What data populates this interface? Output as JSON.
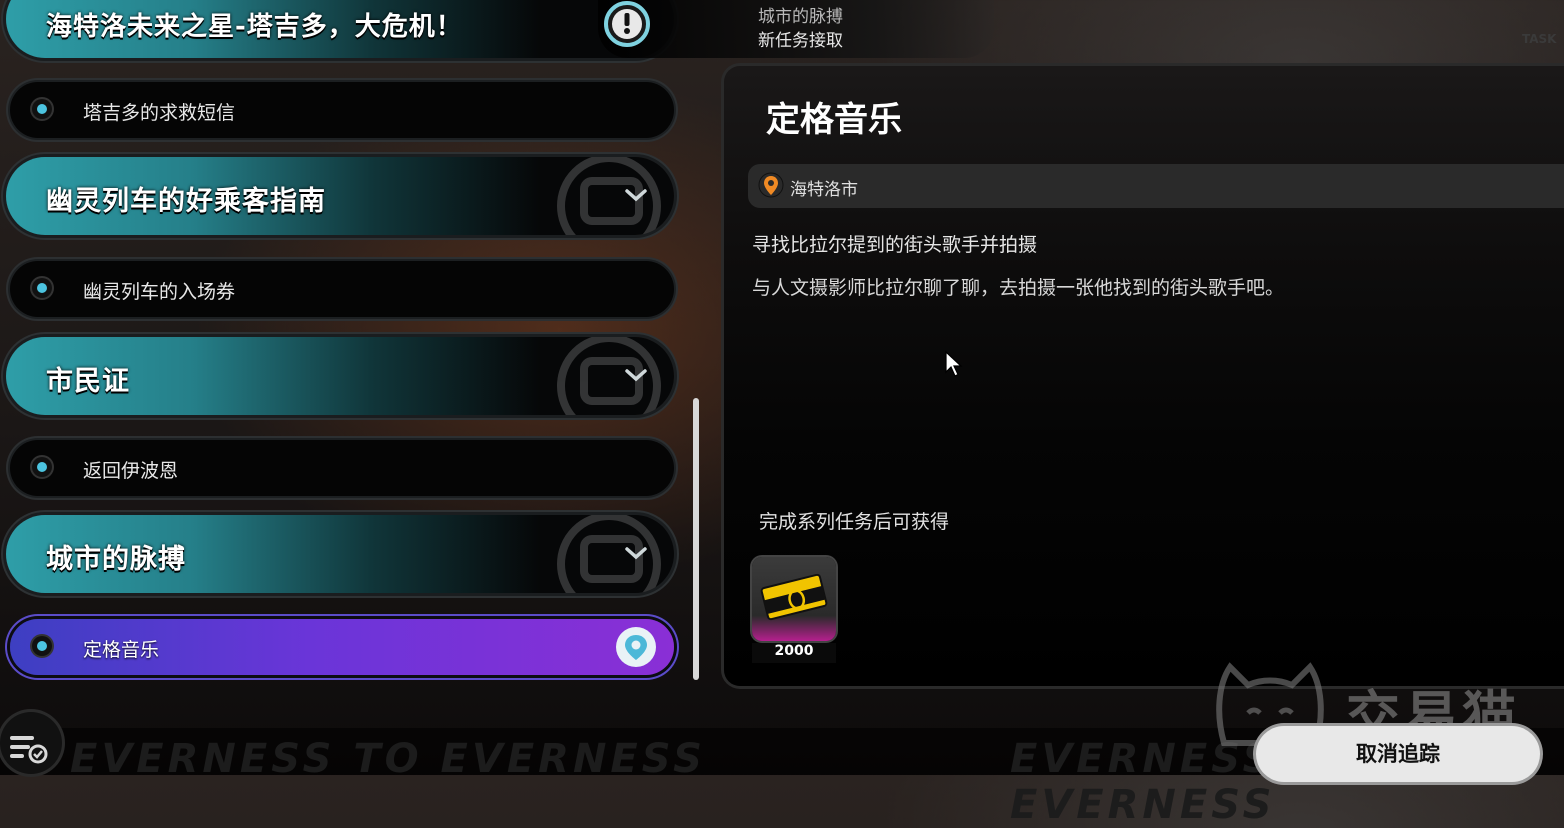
{
  "quest_list": {
    "top_partial_title": "海特洛未来之星-塔吉多，大危机！",
    "categories": [
      {
        "title": "幽灵列车的好乘客指南"
      },
      {
        "title": "市民证"
      },
      {
        "title": "城市的脉搏"
      }
    ],
    "items": [
      {
        "label": "塔吉多的求救短信"
      },
      {
        "label": "幽灵列车的入场券"
      },
      {
        "label": "返回伊波恩"
      },
      {
        "label": "定格音乐"
      }
    ]
  },
  "notification": {
    "line1": "城市的脉搏",
    "line2": "新任务接取",
    "corner_text": "TASK"
  },
  "detail": {
    "title": "定格音乐",
    "location": "海特洛市",
    "objective": "寻找比拉尔提到的街头歌手并拍摄",
    "description": "与人文摄影师比拉尔聊了聊，去拍摄一张他找到的街头歌手吧。",
    "reward_header": "完成系列任务后可获得",
    "reward_amount": "2000"
  },
  "footer": {
    "cancel_tracking": "取消追踪",
    "watermark": "交易猫",
    "marquee": "EVERNESS TO EVERNESS"
  },
  "colors": {
    "accent_teal": "#2e9ea8",
    "active_purple": "#7a33d8",
    "location_orange": "#f08a24",
    "reward_magenta": "#b5208e"
  }
}
